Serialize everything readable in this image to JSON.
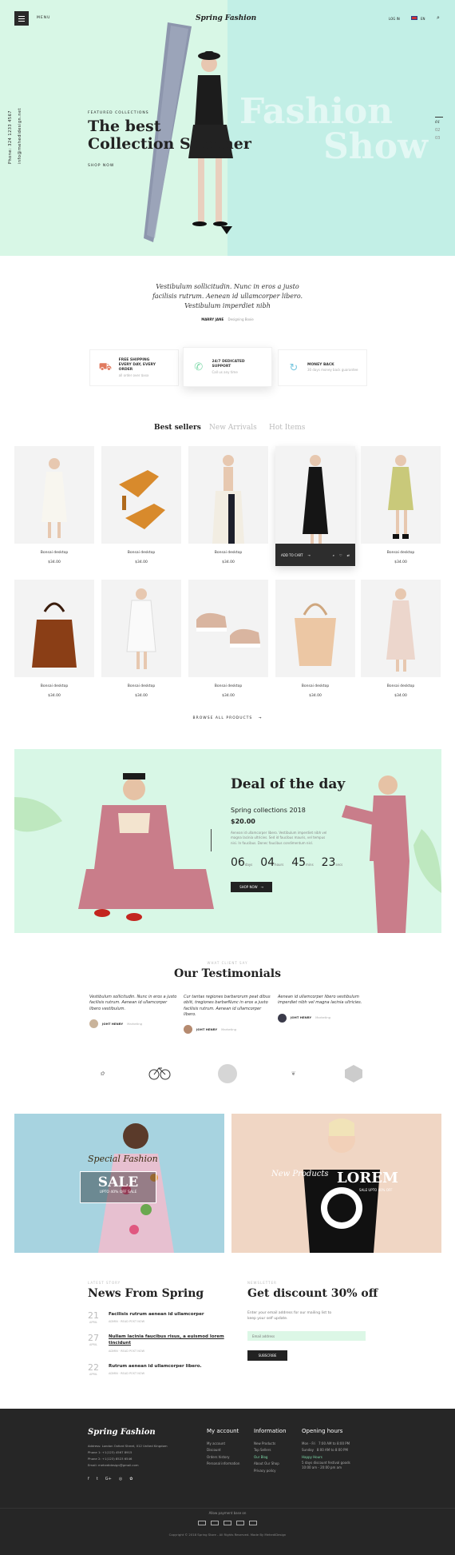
{
  "header": {
    "menu_label": "MENU",
    "brand": "Spring Fashion",
    "login": "LOG IN",
    "language": "EN",
    "colors": {
      "hero_left": "#d8f7e6",
      "hero_right": "#c2efe6",
      "accent": "#7ed9a9"
    }
  },
  "hero": {
    "phone": "Phone: 324 1233 4567",
    "email": "info@mehedidesign.net",
    "eyebrow": "FEATURED COLLECTIONS",
    "title_line1": "The best",
    "title_line2": "Collection Summer",
    "cta": "SHOP NOW",
    "bg_word1": "Fashion",
    "bg_word2": "Show",
    "slides": [
      "01",
      "02",
      "03"
    ]
  },
  "quote": {
    "text_line1": "Vestibulum sollicitudin. Nunc in eros a justo",
    "text_line2": "facilisis rutrum. Aenean id ullamcorper libero.",
    "text_line3": "Vestibulum imperdiet nibh",
    "author": "MARRY JANE",
    "author_role": "Designing Boxie"
  },
  "features": [
    {
      "title1": "FREE SHIPPING",
      "title2": "EVERY DAY, EVERY ORDER",
      "sub": "all order over $xxx",
      "icon": "truck-icon"
    },
    {
      "title1": "24/7 DEDICATED SUPPORT",
      "title2": "",
      "sub": "Call us any time",
      "icon": "phone-icon"
    },
    {
      "title1": "MONEY BACK",
      "title2": "",
      "sub": "30 days money back guarantee",
      "icon": "refresh-icon"
    }
  ],
  "product_tabs": [
    "Best sellers",
    "New Arrivals",
    "Hot Items"
  ],
  "products": [
    {
      "name": "Bonsai desktop",
      "price": "$34.00",
      "image": "white-dress"
    },
    {
      "name": "Bonsai desktop",
      "price": "$34.00",
      "image": "orange-mules"
    },
    {
      "name": "Bonsai desktop",
      "price": "$34.00",
      "image": "cream-trousers"
    },
    {
      "name": "",
      "price": "",
      "image": "black-dress"
    },
    {
      "name": "Bonsai desktop",
      "price": "$34.00",
      "image": "floral-dress"
    },
    {
      "name": "Bonsai desktop",
      "price": "$34.00",
      "image": "brown-bag"
    },
    {
      "name": "Bonsai desktop",
      "price": "$34.00",
      "image": "white-shirt-dress"
    },
    {
      "name": "Bonsai desktop",
      "price": "$34.00",
      "image": "pink-sneakers"
    },
    {
      "name": "Bonsai desktop",
      "price": "$34.00",
      "image": "tan-tote"
    },
    {
      "name": "Bonsai desktop",
      "price": "$34.00",
      "image": "pink-dress"
    }
  ],
  "hover_card": {
    "add_to_cart": "ADD TO CART"
  },
  "browse_all": "BROWSE ALL PRODUCTS",
  "deal": {
    "title": "Deal of the day",
    "subtitle": "Spring collections 2018",
    "price": "$20.00",
    "description": "Aenean id ullamcorper libero. Vestibulum imperdiet nibh vel magna lacinia ultricies. Sed id faucibus mauris, vel tempus nisi. In faucibus. Donec faucibus condimentum nisl.",
    "countdown": [
      {
        "value": "06",
        "unit": "days"
      },
      {
        "value": "04",
        "unit": "hours"
      },
      {
        "value": "45",
        "unit": "mins"
      },
      {
        "value": "23",
        "unit": "secs"
      }
    ],
    "cta": "SHOP NOW"
  },
  "testimonials": {
    "eyebrow": "WHAT CLIENT SAY",
    "title": "Our Testimonials",
    "items": [
      {
        "text": "Vestibulum sollicitudin. Nunc in eros a justo facilisis rutrum. Aenean id ullamcorper libero vestibulum.",
        "author": "JOHT HENRY",
        "role": "Marketing"
      },
      {
        "text": "Cur tantas regiones barbarorum peat dibus obiit, tregiones barbarNunc in eros a justo facilisis rutrum. Aenean id ullamcorper libero.",
        "author": "JOHT HENRY",
        "role": "Marketing"
      },
      {
        "text": "Aenean id ullamcorper libero vestibulum imperdiet nibh vel magna lacinia ultricies.",
        "author": "JOHT HENRY",
        "role": "Marketing"
      }
    ]
  },
  "banners": {
    "left_top": "Special Fashion",
    "left_main": "SALE",
    "left_sub": "UPTO 40% OFF SALE",
    "right_top": "New Products",
    "right_main": "LOREM",
    "right_sub": "SALE UPTO 40% OFF",
    "tshirt_text": "THE DIVER SUPPLY CO WORLDWIDE"
  },
  "news": {
    "eyebrow": "LATEST STORY",
    "title": "News From Spring",
    "items": [
      {
        "day": "21",
        "month": "APRIL",
        "title": "Facilisis rutrum aenean id ullamcorper",
        "meta": "ADMIN  ·  READ POST NOW"
      },
      {
        "day": "27",
        "month": "APRIL",
        "title": "Nullam lacinia faucibus risus, a euismod lorem tincidunt",
        "meta": "ADMIN  ·  READ POST NOW"
      },
      {
        "day": "22",
        "month": "APRIL",
        "title": "Rutrum aenean id ullamcorper libero.",
        "meta": "ADMIN  ·  READ POST NOW"
      }
    ]
  },
  "newsletter": {
    "eyebrow": "NEWSLETTER",
    "title": "Get discount 30% off",
    "text": "Enter your email address for our mailing list to keep your self update.",
    "placeholder": "Email address",
    "button": "SUBSCRIBE"
  },
  "footer": {
    "brand": "Spring Fashion",
    "address": "Address: London Oxford Street, 012 United Kingdom",
    "phone1": "Phone 1: +1(123) 4567 8915",
    "phone2": "Phone 2: +1(123) 8523 6546",
    "email": "Email: mehedidesign@gmail.com",
    "social": [
      "f",
      "t",
      "G+",
      "◎",
      "✿"
    ],
    "account_title": "My account",
    "account_links": [
      "My account",
      "Discount",
      "Orders history",
      "Personal information"
    ],
    "info_title": "Information",
    "info_links": [
      "New Products",
      "Top Sellers",
      "Our Blog",
      "About Our Shop",
      "Privacy policy"
    ],
    "hours_title": "Opening hours",
    "hours": [
      {
        "day": "Mon - Fri",
        "time": "7:00 AM to 8:00 PM"
      },
      {
        "day": "Sunday",
        "time": "8:00 AM to 8:00 PM"
      }
    ],
    "happy_hours": "Happy Hours",
    "happy_line1": "5 days discount festival goods",
    "happy_line2": "10:00 am - 20:00 pm am",
    "payment_label": "Allow payment base on",
    "payment_icons": [
      "visa-icon",
      "mastercard-icon",
      "paypal-icon",
      "card-icon",
      "bank-icon"
    ],
    "copyright": "Copyright © 2018 Spring Store - All Rights Reserved. Made By MehediDesign"
  }
}
